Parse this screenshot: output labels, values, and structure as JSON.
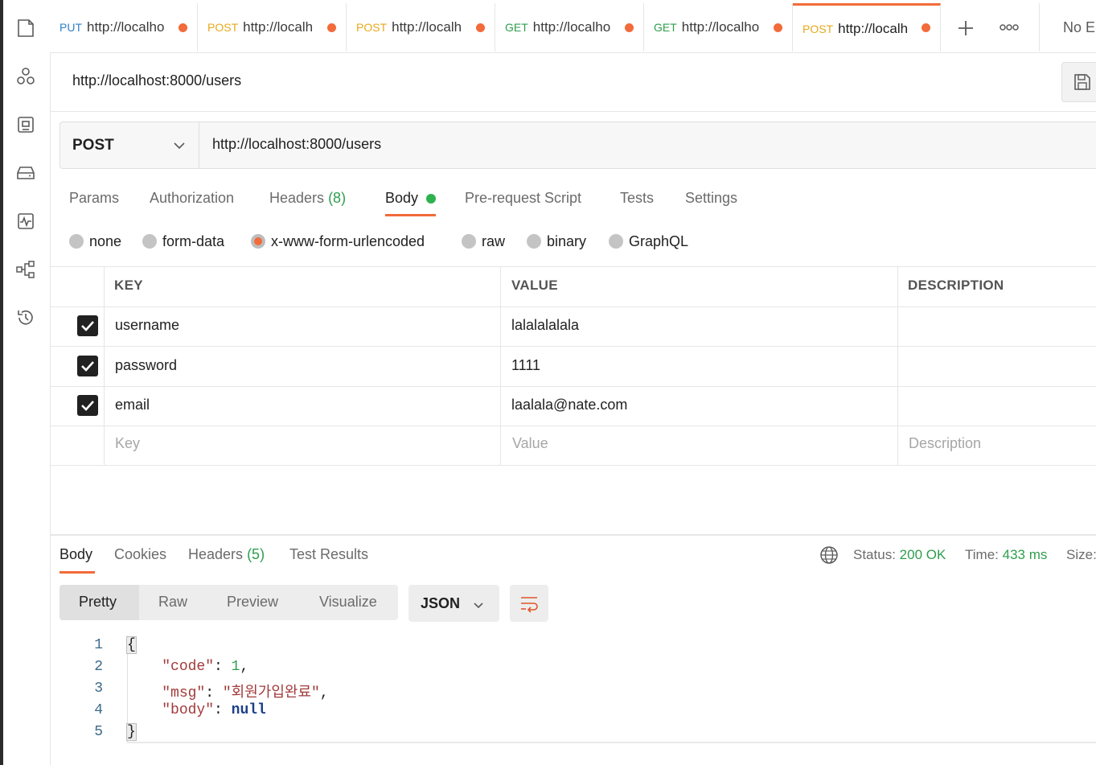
{
  "tabs": [
    {
      "method": "PUT",
      "method_color": "#2f7fc7",
      "url": "http://localho",
      "active": false
    },
    {
      "method": "POST",
      "method_color": "#e6a91a",
      "url": "http://localh",
      "active": false
    },
    {
      "method": "POST",
      "method_color": "#e6a91a",
      "url": "http://localh",
      "active": false
    },
    {
      "method": "GET",
      "method_color": "#2e9e4e",
      "url": "http://localho",
      "active": false
    },
    {
      "method": "GET",
      "method_color": "#2e9e4e",
      "url": "http://localho",
      "active": false
    },
    {
      "method": "POST",
      "method_color": "#e6a91a",
      "url": "http://localh",
      "active": true
    }
  ],
  "tabbar": {
    "new_tab_icon": "plus-icon",
    "more_icon": "more-horizontal-icon",
    "environment": "No En"
  },
  "sidebar": {
    "icons": [
      "collections-icon",
      "apis-icon",
      "environments-icon",
      "mock-servers-icon",
      "monitors-icon",
      "flows-icon",
      "history-icon"
    ]
  },
  "request": {
    "title": "http://localhost:8000/users",
    "method": "POST",
    "url": "http://localhost:8000/users",
    "tabs": {
      "params": "Params",
      "authorization": "Authorization",
      "headers": "Headers",
      "headers_count": "(8)",
      "body": "Body",
      "prerequest": "Pre-request Script",
      "tests": "Tests",
      "settings": "Settings"
    },
    "body_types": [
      "none",
      "form-data",
      "x-www-form-urlencoded",
      "raw",
      "binary",
      "GraphQL"
    ],
    "body_type_selected": "x-www-form-urlencoded",
    "table": {
      "headers": {
        "key": "KEY",
        "value": "VALUE",
        "description": "DESCRIPTION"
      },
      "rows": [
        {
          "checked": true,
          "key": "username",
          "value": "lalalalalala",
          "description": ""
        },
        {
          "checked": true,
          "key": "password",
          "value": "1111",
          "description": ""
        },
        {
          "checked": true,
          "key": "email",
          "value": "laalala@nate.com",
          "description": ""
        }
      ],
      "placeholders": {
        "key": "Key",
        "value": "Value",
        "description": "Description"
      }
    }
  },
  "response": {
    "tabs": {
      "body": "Body",
      "cookies": "Cookies",
      "headers": "Headers",
      "headers_count": "(5)",
      "test_results": "Test Results"
    },
    "status_label": "Status:",
    "status_value": "200 OK",
    "time_label": "Time:",
    "time_value": "433 ms",
    "size_label": "Size:",
    "views": [
      "Pretty",
      "Raw",
      "Preview",
      "Visualize"
    ],
    "view_selected": "Pretty",
    "format": "JSON",
    "line_numbers": [
      "1",
      "2",
      "3",
      "4",
      "5"
    ],
    "code": {
      "open": "{",
      "code_key": "\"code\"",
      "code_val": "1",
      "msg_key": "\"msg\"",
      "msg_val": "\"회원가입완료\"",
      "body_key": "\"body\"",
      "body_val": "null",
      "close": "}"
    }
  }
}
